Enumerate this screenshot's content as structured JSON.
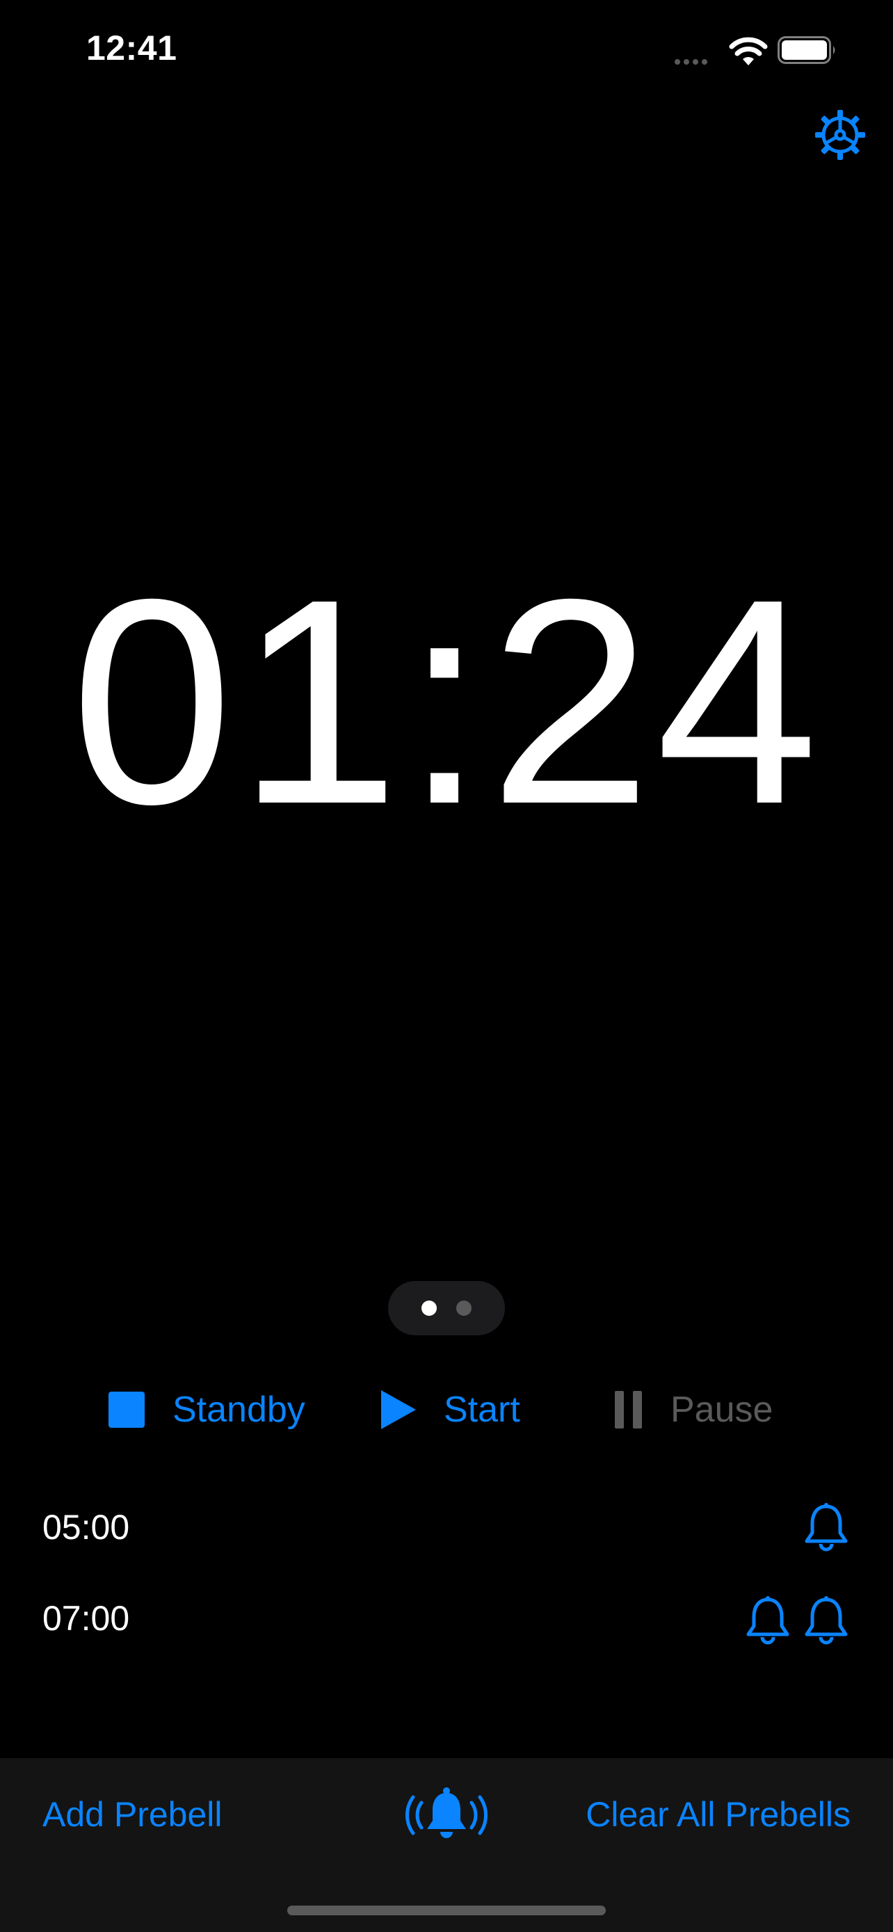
{
  "status_bar": {
    "time": "12:41"
  },
  "timer": {
    "display": "01:24"
  },
  "page_indicator": {
    "total": 2,
    "active": 1
  },
  "controls": {
    "standby_label": "Standby",
    "start_label": "Start",
    "pause_label": "Pause"
  },
  "prebells": [
    {
      "time": "05:00",
      "bells": 1
    },
    {
      "time": "07:00",
      "bells": 2
    }
  ],
  "toolbar": {
    "add_label": "Add Prebell",
    "clear_label": "Clear All Prebells"
  },
  "colors": {
    "accent": "#0a84ff",
    "background": "#000000",
    "toolbar_bg": "#141414",
    "disabled": "#5a5a5a"
  },
  "icons": {
    "settings": "gear-icon",
    "standby": "stop-square-icon",
    "start": "play-icon",
    "pause": "pause-icon",
    "prebell": "bell-icon",
    "ring": "bell-ringing-icon"
  }
}
